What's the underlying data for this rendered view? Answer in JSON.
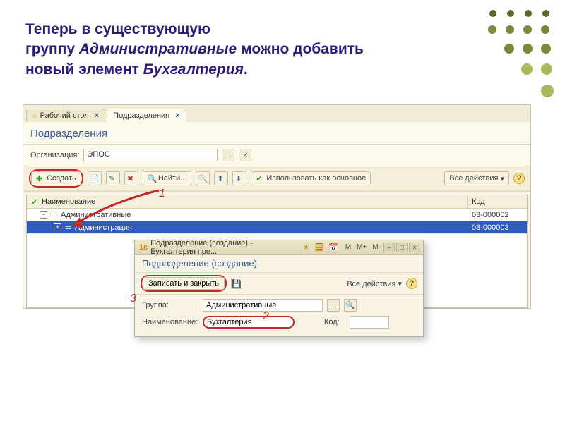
{
  "heading": {
    "l1a": "Теперь в существующую",
    "l1b": "группу ",
    "l1c": "Административные",
    "l1d": " можно добавить",
    "l2a": "новый элемент ",
    "l2b": "Бухгалтерия",
    "l2c": "."
  },
  "tabs": {
    "desktop": "Рабочий стол",
    "sub": "Подразделения"
  },
  "main": {
    "title": "Подразделения",
    "org_label": "Организация:",
    "org_value": "ЭПОС"
  },
  "toolbar": {
    "create": "Создать",
    "find": "Найти...",
    "use_main": "Использовать как основное",
    "all_actions": "Все действия"
  },
  "table": {
    "col_name": "Наименование",
    "col_code": "Код",
    "rows": [
      {
        "name": "Административные",
        "code": "03-000002"
      },
      {
        "name": "Администрация",
        "code": "03-000003"
      }
    ]
  },
  "dialog": {
    "title_bar": "Подразделение (создание) - Бухгалтерия пре...",
    "calc": [
      "M",
      "M+",
      "M-"
    ],
    "title": "Подразделение (создание)",
    "save_close": "Записать и закрыть",
    "all_actions": "Все действия",
    "grp_label": "Группа:",
    "grp_value": "Административные",
    "name_label": "Наименование:",
    "name_value": "Бухгалтерия",
    "code_label": "Код:"
  },
  "annot": {
    "a1": "1",
    "a2": "2",
    "a3": "3"
  }
}
